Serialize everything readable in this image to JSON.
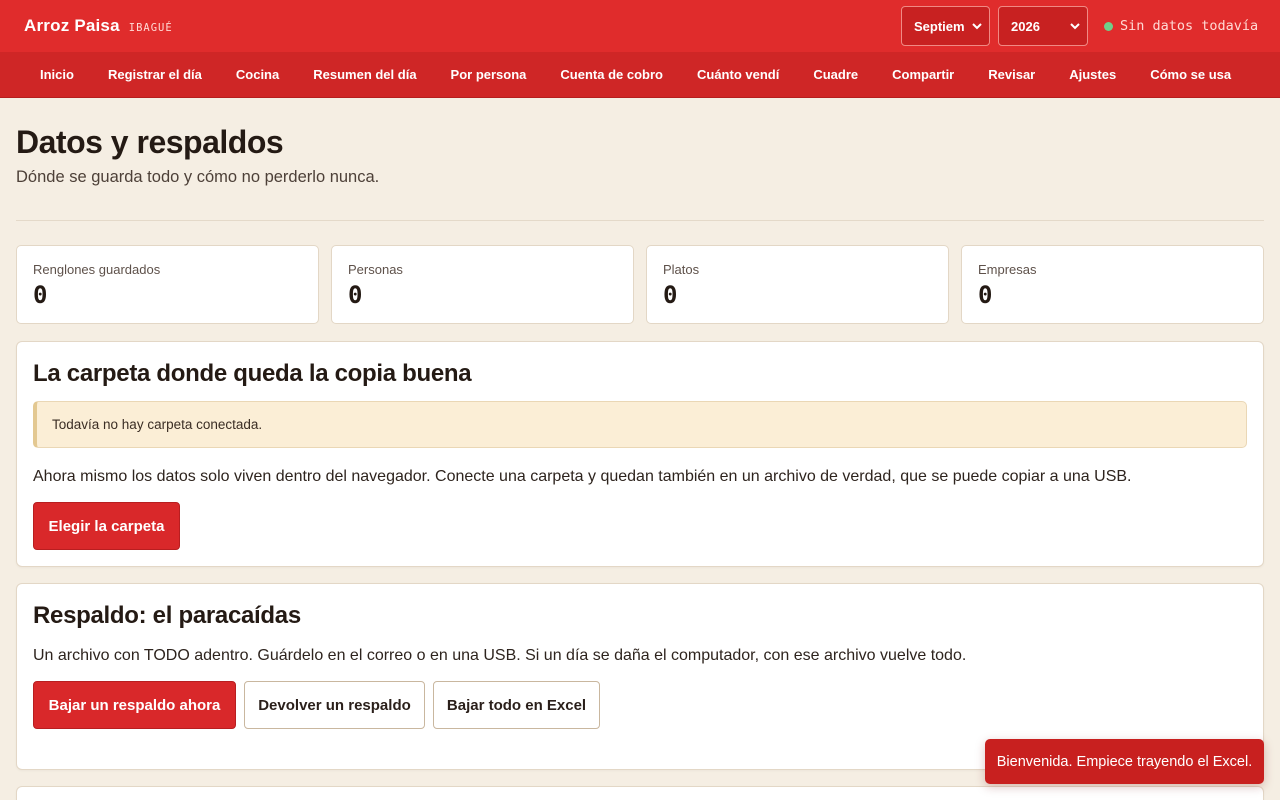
{
  "header": {
    "brand": "Arroz Paisa",
    "city": "IBAGUÉ",
    "month_selected": "Septiem",
    "year_selected": "2026",
    "status": "Sin datos todavía"
  },
  "nav": [
    "Inicio",
    "Registrar el día",
    "Cocina",
    "Resumen del día",
    "Por persona",
    "Cuenta de cobro",
    "Cuánto vendí",
    "Cuadre",
    "Compartir",
    "Revisar",
    "Ajustes",
    "Cómo se usa"
  ],
  "page": {
    "title": "Datos y respaldos",
    "subtitle": "Dónde se guarda todo y cómo no perderlo nunca."
  },
  "stats": [
    {
      "label": "Renglones guardados",
      "value": "0"
    },
    {
      "label": "Personas",
      "value": "0"
    },
    {
      "label": "Platos",
      "value": "0"
    },
    {
      "label": "Empresas",
      "value": "0"
    }
  ],
  "folder_card": {
    "title": "La carpeta donde queda la copia buena",
    "notice": "Todavía no hay carpeta conectada.",
    "text": "Ahora mismo los datos solo viven dentro del navegador. Conecte una carpeta y quedan también en un archivo de verdad, que se puede copiar a una USB.",
    "button": "Elegir la carpeta"
  },
  "backup_card": {
    "title": "Respaldo: el paracaídas",
    "text": "Un archivo con TODO adentro. Guárdelo en el correo o en una USB. Si un día se daña el computador, con ese archivo vuelve todo.",
    "button_download": "Bajar un respaldo ahora",
    "button_restore": "Devolver un respaldo",
    "button_excel": "Bajar todo en Excel"
  },
  "toast": "Bienvenida. Empiece trayendo el Excel.",
  "colors": {
    "topbar": "#e02c2c",
    "nav": "#cf2626",
    "background": "#f5eee3",
    "primary_button": "#d9282a",
    "status_dot": "#6fcf8a",
    "notice_bg": "#fbeed6"
  },
  "icons": {
    "select_arrow": "chevron-down-icon",
    "status_indicator": "status-dot-icon"
  }
}
